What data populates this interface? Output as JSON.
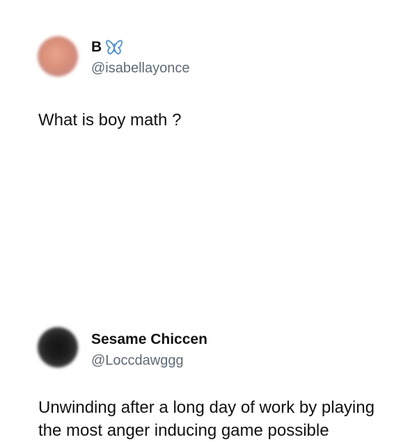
{
  "posts": [
    {
      "author": {
        "display_name": "B",
        "handle": "@isabellayonce",
        "name_icon": "butterfly-icon",
        "avatar": "blurred-avatar"
      },
      "text_lines": [
        "What is boy math ?"
      ]
    },
    {
      "author": {
        "display_name": "Sesame Chiccen",
        "handle": "@Loccdawggg",
        "avatar": "blurred-avatar"
      },
      "text_lines": [
        "Unwinding after a long day of work by playing",
        "the most anger inducing game possible"
      ]
    }
  ],
  "colors": {
    "background": "#ffffff",
    "text": "#111111",
    "handle": "#5e6a75",
    "butterfly": "#4a90d9"
  }
}
